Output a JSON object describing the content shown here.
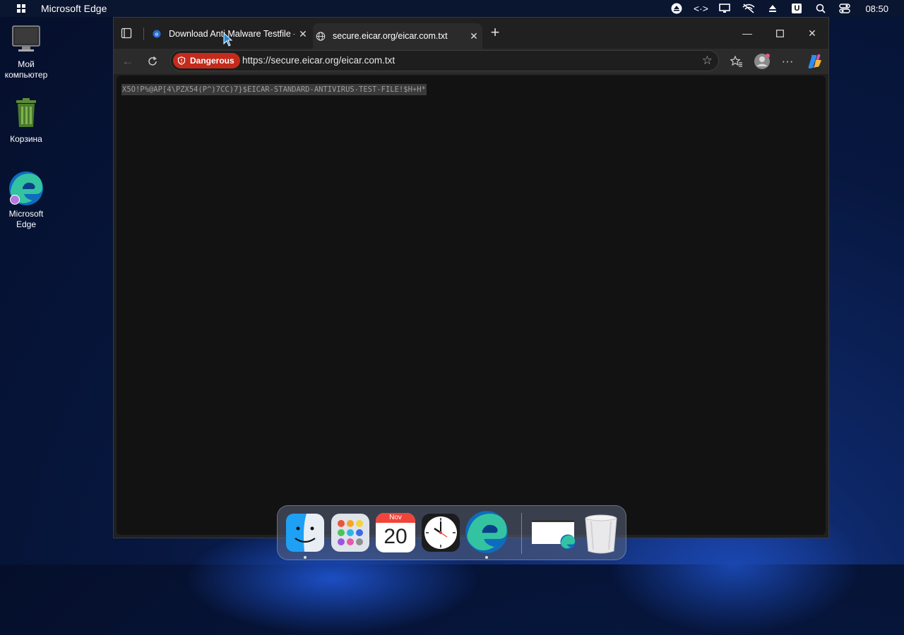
{
  "menubar": {
    "app_name": "Microsoft Edge",
    "clock": "08:50",
    "tray_u": "U"
  },
  "desktop": {
    "icons": [
      {
        "label_line1": "Мой",
        "label_line2": "компьютер"
      },
      {
        "label_line1": "Корзина",
        "label_line2": ""
      },
      {
        "label_line1": "Microsoft",
        "label_line2": "Edge"
      }
    ]
  },
  "browser": {
    "tabs": [
      {
        "title": "Download Anti Malware Testfile -",
        "active": false
      },
      {
        "title": "secure.eicar.org/eicar.com.txt",
        "active": true
      }
    ],
    "security_badge": "Dangerous",
    "url": "https://secure.eicar.org/eicar.com.txt",
    "page_text": "X5O!P%@AP[4\\PZX54(P^)7CC)7}$EICAR-STANDARD-ANTIVIRUS-TEST-FILE!$H+H*"
  },
  "dock": {
    "calendar_month": "Nov",
    "calendar_day": "20"
  },
  "colors": {
    "danger": "#c42b1c",
    "window_bg": "#202020",
    "content_bg": "#121212"
  }
}
